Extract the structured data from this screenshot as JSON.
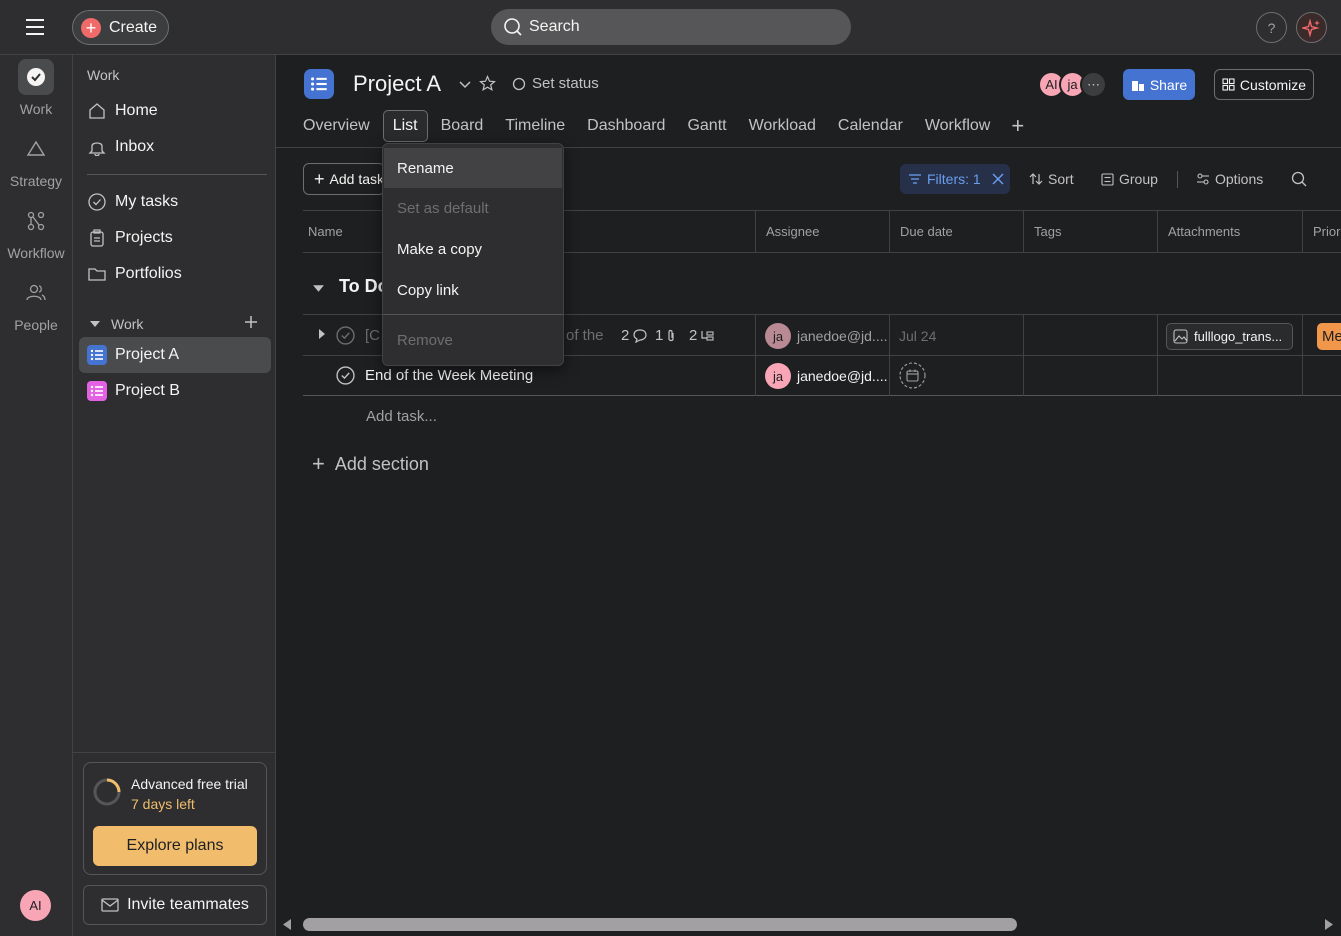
{
  "topbar": {
    "create_label": "Create",
    "search_placeholder": "Search",
    "help_label": "?"
  },
  "rail": {
    "items": [
      {
        "label": "Work"
      },
      {
        "label": "Strategy"
      },
      {
        "label": "Workflow"
      },
      {
        "label": "People"
      }
    ],
    "user_initials": "AI"
  },
  "sidebar": {
    "header": "Work",
    "nav": [
      {
        "label": "Home"
      },
      {
        "label": "Inbox"
      }
    ],
    "nav2": [
      {
        "label": "My tasks"
      },
      {
        "label": "Projects"
      },
      {
        "label": "Portfolios"
      }
    ],
    "section_title": "Work",
    "projects": [
      {
        "label": "Project A",
        "color": "#4573d2"
      },
      {
        "label": "Project B",
        "color": "#e362e3"
      }
    ],
    "trial_title": "Advanced free trial",
    "trial_days": "7 days left",
    "explore_label": "Explore plans",
    "invite_label": "Invite teammates"
  },
  "project": {
    "title": "Project A",
    "set_status": "Set status",
    "members": [
      {
        "initials": "AI",
        "color": "#f8a5b5"
      },
      {
        "initials": "ja",
        "color": "#f8a5b5"
      }
    ],
    "share_label": "Share",
    "customize_label": "Customize"
  },
  "tabs": [
    {
      "label": "Overview"
    },
    {
      "label": "List"
    },
    {
      "label": "Board"
    },
    {
      "label": "Timeline"
    },
    {
      "label": "Dashboard"
    },
    {
      "label": "Gantt"
    },
    {
      "label": "Workload"
    },
    {
      "label": "Calendar"
    },
    {
      "label": "Workflow"
    }
  ],
  "toolbar": {
    "add_task": "Add task",
    "filters": "Filters: 1",
    "sort": "Sort",
    "group": "Group",
    "options": "Options"
  },
  "table": {
    "columns": [
      "Name",
      "Assignee",
      "Due date",
      "Tags",
      "Attachments",
      "Prior"
    ],
    "section": "To Do",
    "rows": [
      {
        "name_prefix": "[C",
        "name_suffix": "of the",
        "subtasks": "2",
        "comments": "1",
        "attachments_count": "2",
        "assignee_initials": "ja",
        "assignee": "janedoe@jd....",
        "due": "Jul 24",
        "attachment": "fulllogo_trans...",
        "priority": "Me"
      },
      {
        "name": "End of the Week Meeting",
        "assignee_initials": "ja",
        "assignee": "janedoe@jd...."
      }
    ],
    "add_task_placeholder": "Add task...",
    "add_section": "Add section"
  },
  "tab_menu": {
    "items": [
      {
        "label": "Rename"
      },
      {
        "label": "Set as default"
      },
      {
        "label": "Make a copy"
      },
      {
        "label": "Copy link"
      },
      {
        "label": "Remove"
      }
    ]
  }
}
